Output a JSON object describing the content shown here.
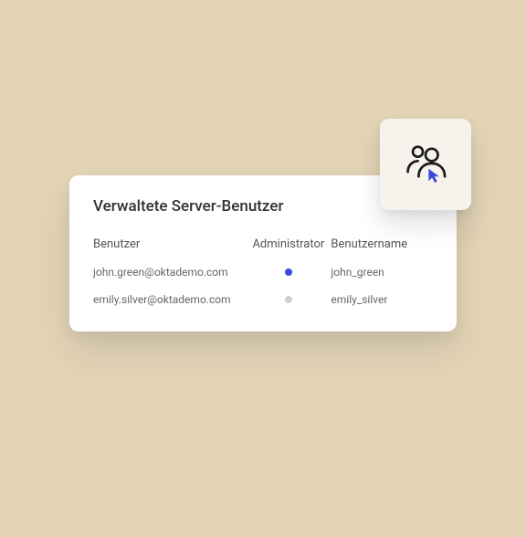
{
  "card": {
    "title": "Verwaltete Server-Benutzer",
    "columns": {
      "user": "Benutzer",
      "admin": "Administrator",
      "username": "Benutzername"
    },
    "rows": [
      {
        "user": "john.green@oktademo.com",
        "admin": true,
        "username": "john_green"
      },
      {
        "user": "emily.silver@oktademo.com",
        "admin": false,
        "username": "emily_silver"
      }
    ]
  },
  "icon": {
    "name": "users-cursor-icon"
  }
}
